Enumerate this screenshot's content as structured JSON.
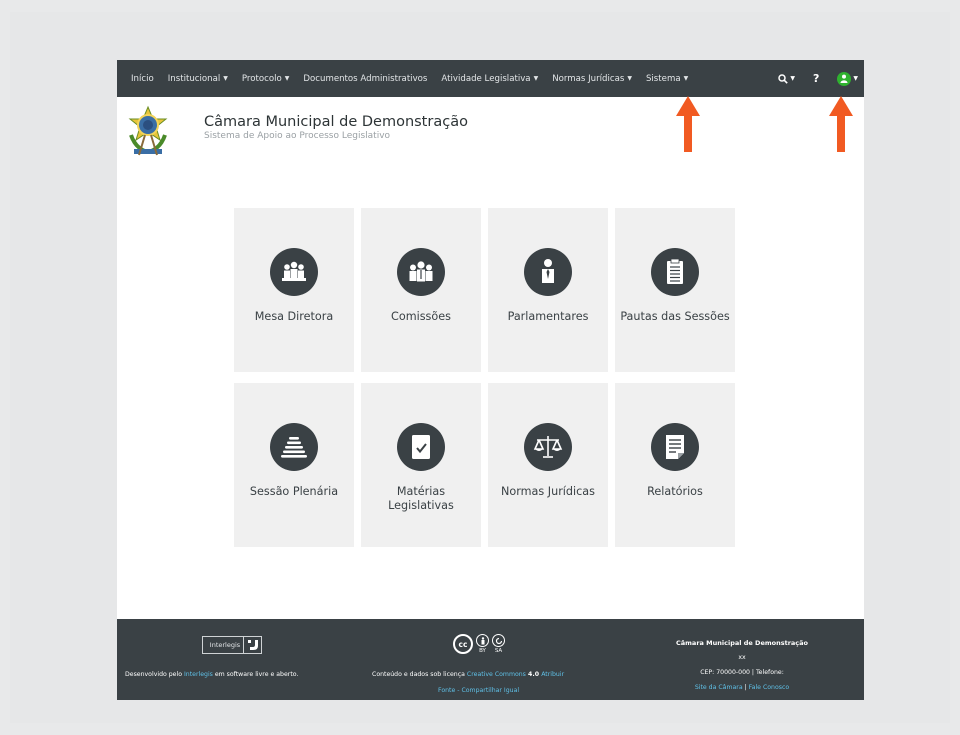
{
  "navbar": {
    "items": [
      {
        "label": "Início",
        "dropdown": false
      },
      {
        "label": "Institucional",
        "dropdown": true
      },
      {
        "label": "Protocolo",
        "dropdown": true
      },
      {
        "label": "Documentos Administrativos",
        "dropdown": false
      },
      {
        "label": "Atividade Legislativa",
        "dropdown": true
      },
      {
        "label": "Normas Jurídicas",
        "dropdown": true
      },
      {
        "label": "Sistema",
        "dropdown": true
      }
    ],
    "help_label": "?",
    "colors": {
      "bar": "#3a4145",
      "user_icon": "#2fb22f"
    }
  },
  "header": {
    "title": "Câmara Municipal de Demonstração",
    "subtitle": "Sistema de Apoio ao Processo Legislativo"
  },
  "annotations": {
    "arrow_color": "#f15a22"
  },
  "tiles": [
    {
      "label": "Mesa Diretora",
      "icon": "mesa-diretora-icon"
    },
    {
      "label": "Comissões",
      "icon": "comissoes-icon"
    },
    {
      "label": "Parlamentares",
      "icon": "parlamentares-icon"
    },
    {
      "label": "Pautas das Sessões",
      "icon": "pautas-icon"
    },
    {
      "label": "Sessão Plenária",
      "icon": "sessao-plenaria-icon"
    },
    {
      "label": "Matérias Legislativas",
      "icon": "materias-icon"
    },
    {
      "label": "Normas Jurídicas",
      "icon": "normas-icon"
    },
    {
      "label": "Relatórios",
      "icon": "relatorios-icon"
    }
  ],
  "footer": {
    "interlegis_logo_text": "Interlegis",
    "dev_prefix": "Desenvolvido pelo ",
    "dev_link": "Interlegis",
    "dev_suffix": " em software livre e aberto.",
    "cc_label": "cc",
    "cc_by": "BY",
    "cc_sa": "SA",
    "license_prefix": "Conteúdo e dados sob licença ",
    "license_link": "Creative Commons",
    "license_version": " 4.0 ",
    "license_attr": "Atribuir",
    "license_line2": "Fonte - Compartilhar Igual",
    "org_name": "Câmara Municipal de Demonstração",
    "org_xx": "xx",
    "org_cep": "CEP: 70000-000 | Telefone:",
    "link_site": "Site da Câmara",
    "link_sep": " | ",
    "link_contact": "Fale Conosco"
  }
}
